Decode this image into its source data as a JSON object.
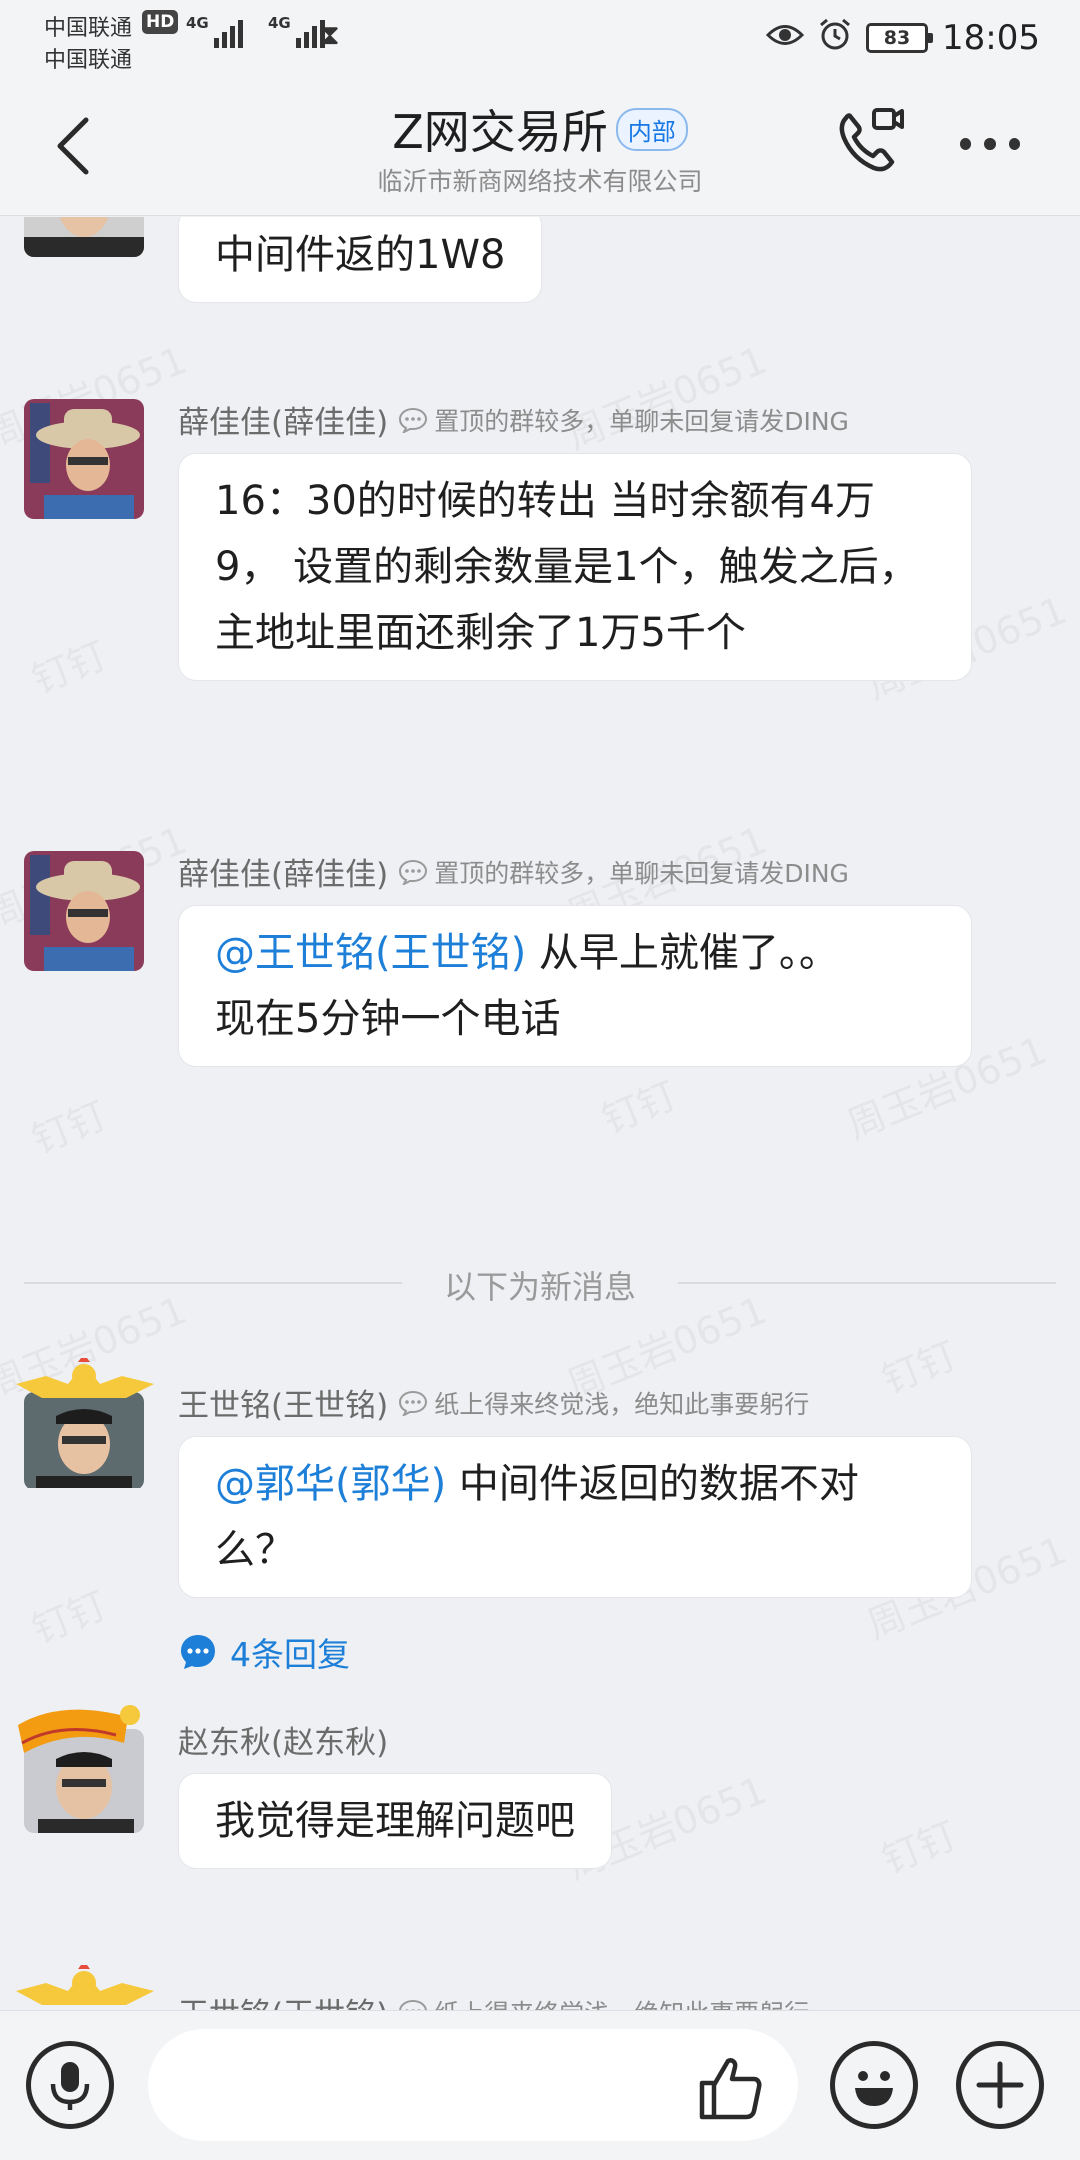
{
  "status_bar": {
    "carrier1": "中国联通",
    "carrier2": "中国联通",
    "hd": "HD",
    "net1": "4G",
    "net2": "4G",
    "battery": "83",
    "time": "18:05"
  },
  "header": {
    "title": "Z网交易所",
    "badge": "内部",
    "subtitle": "临沂市新商网络技术有限公司"
  },
  "watermark_texts": [
    "周玉岩0651",
    "钉钉"
  ],
  "messages": [
    {
      "text": "中间件返的1W8"
    },
    {
      "sender": "薛佳佳(薛佳佳)",
      "signature": "置顶的群较多，单聊未回复请发DING",
      "text": "16：30的时候的转出   当时余额有4万9，  设置的剩余数量是1个，触发之后，  主地址里面还剩余了1万5千个"
    },
    {
      "sender": "薛佳佳(薛佳佳)",
      "signature": "置顶的群较多，单聊未回复请发DING",
      "mention": "@王世铭(王世铭)",
      "text": " 从早上就催了。。现在5分钟一个电话"
    },
    {
      "divider": "以下为新消息"
    },
    {
      "sender": "王世铭(王世铭)",
      "signature": "纸上得来终觉浅，绝知此事要躬行",
      "mention": "@郭华(郭华)",
      "text": " 中间件返回的数据不对么？",
      "replies": "4条回复"
    },
    {
      "sender": "赵东秋(赵东秋)",
      "text": "我觉得是理解问题吧"
    },
    {
      "sender": "王世铭(王世铭)",
      "signature": "纸上得来终觉浅，绝知此事要躬行"
    }
  ],
  "input": {
    "placeholder": ""
  }
}
